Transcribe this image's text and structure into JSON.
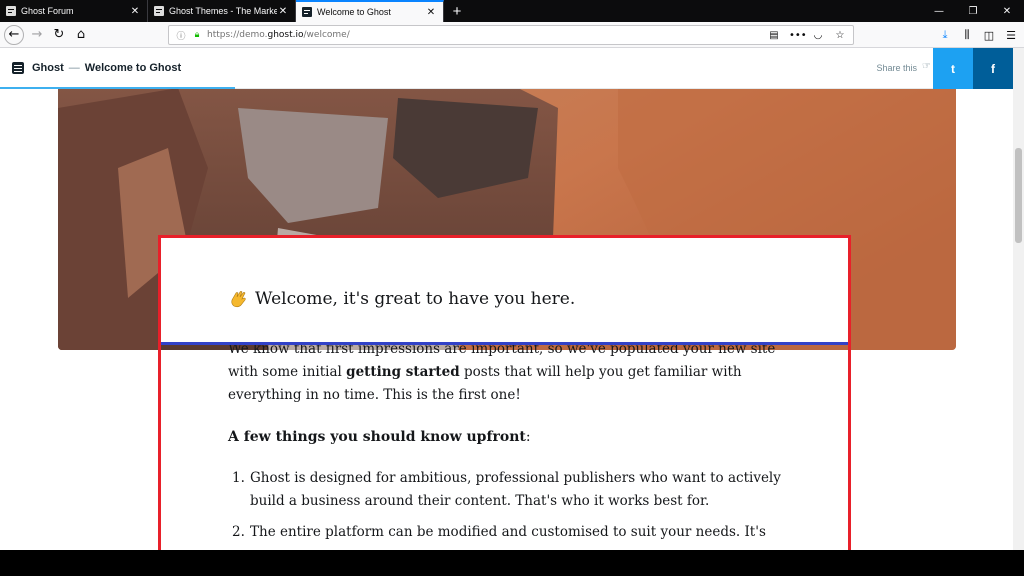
{
  "browser": {
    "tabs": [
      {
        "title": "Ghost Forum",
        "active": false
      },
      {
        "title": "Ghost Themes - The Marketplac",
        "active": false
      },
      {
        "title": "Welcome to Ghost",
        "active": true
      }
    ],
    "new_tab": "+",
    "url_prefix": "https://demo.",
    "url_domain": "ghost.io",
    "url_path": "/welcome/"
  },
  "ghost_header": {
    "site_name": "Ghost",
    "separator": "—",
    "post_title": "Welcome to Ghost",
    "share_label": "Share this",
    "twitter": "t",
    "facebook": "f"
  },
  "article": {
    "intro_heading": "Welcome, it's great to have you here.",
    "para1_a": "We know that first impressions are important, so we've populated your new site with some initial ",
    "para1_bold": "getting started",
    "para1_b": " posts that will help you get familiar with everything in no time. This is the first one!",
    "heading_bold": "A few things you should know upfront",
    "heading_colon": ":",
    "list": [
      {
        "num": "1.",
        "text": "Ghost is designed for ambitious, professional publishers who want to actively build a business around their content. That's who it works best for."
      },
      {
        "num": "2.",
        "text": "The entire platform can be modified and customised to suit your needs. It's"
      }
    ]
  },
  "colors": {
    "tab_accent": "#0a84ff",
    "twitter": "#1da1f2",
    "facebook": "#005e99",
    "annotation_box": "#e8202a",
    "annotation_line": "#3242c8"
  }
}
